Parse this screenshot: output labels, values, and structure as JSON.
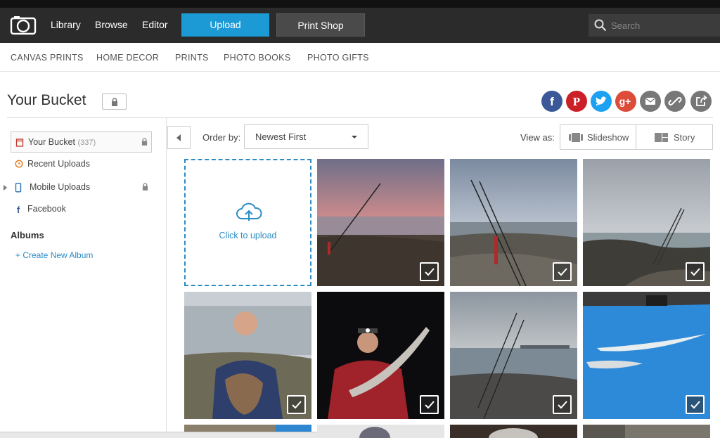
{
  "header": {
    "nav": [
      "Library",
      "Browse",
      "Editor"
    ],
    "upload_label": "Upload",
    "print_label": "Print Shop",
    "search_placeholder": "Search"
  },
  "subnav": [
    "CANVAS PRINTS",
    "HOME DECOR",
    "PRINTS",
    "PHOTO BOOKS",
    "PHOTO GIFTS"
  ],
  "page": {
    "title": "Your Bucket"
  },
  "social": [
    {
      "icon": "facebook-icon",
      "glyph": "f",
      "color": "#3b5998"
    },
    {
      "icon": "pinterest-icon",
      "glyph": "P",
      "color": "#cb2027"
    },
    {
      "icon": "twitter-icon",
      "glyph": "t",
      "color": "#1da1f2"
    },
    {
      "icon": "googleplus-icon",
      "glyph": "g+",
      "color": "#dd4b39"
    },
    {
      "icon": "email-icon",
      "glyph": "",
      "color": "#777777"
    },
    {
      "icon": "link-icon",
      "glyph": "",
      "color": "#777777"
    },
    {
      "icon": "share-icon",
      "glyph": "",
      "color": "#777777"
    }
  ],
  "sidebar": {
    "bucket_label": "Your Bucket",
    "bucket_count": "(337)",
    "recent_label": "Recent Uploads",
    "mobile_label": "Mobile Uploads",
    "facebook_label": "Facebook",
    "albums_heading": "Albums",
    "create_album": "+ Create New Album"
  },
  "toolbar": {
    "order_label": "Order by:",
    "order_value": "Newest First",
    "view_label": "View as:",
    "slideshow_label": "Slideshow",
    "story_label": "Story"
  },
  "grid": {
    "upload_text": "Click to upload"
  },
  "colors": {
    "accent": "#1c9ad6",
    "header": "#2b2b2b",
    "link": "#2b8cc4"
  }
}
